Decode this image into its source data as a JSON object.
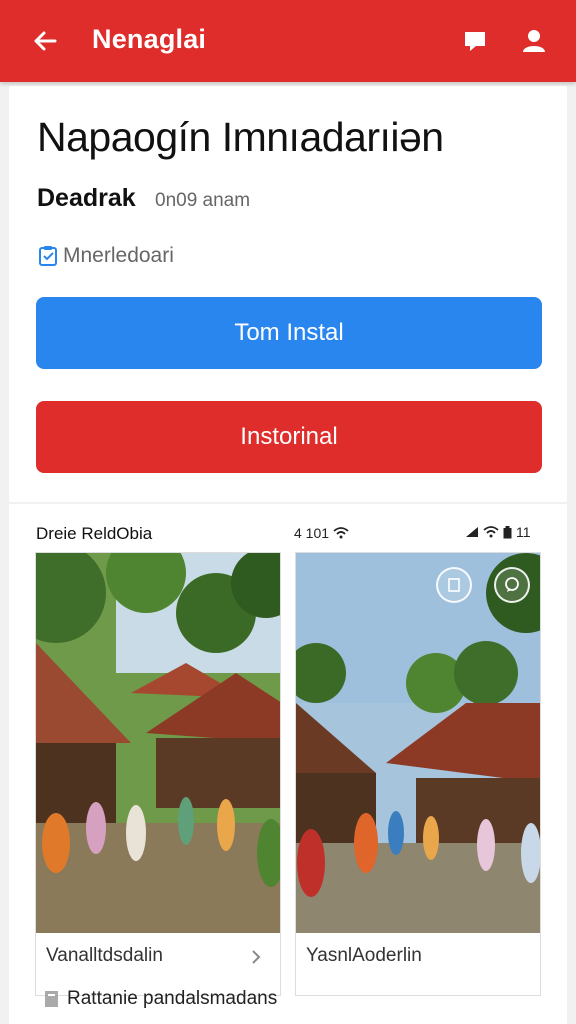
{
  "header": {
    "title": "Nenaglai",
    "back_icon": "arrow-left-icon",
    "chat_icon": "chat-bubble-icon",
    "user_icon": "user-icon",
    "color": "#de2d2a"
  },
  "app": {
    "name": "Napaogín Imnıadarıiən",
    "developer": "Deadrak",
    "meta": "0n09 anam",
    "category": "Mnerledoari"
  },
  "buttons": {
    "primary_label": "Tom Instal",
    "primary_color": "#2a86ef",
    "secondary_label": "Instorinal",
    "secondary_color": "#de2d2a"
  },
  "screenshots": {
    "heading": "Dreie ReldObia",
    "status_mid": "4 101",
    "status_right": "11",
    "items": [
      {
        "caption": "Vanalltdsdalin"
      },
      {
        "caption": "YasnlAoderlin"
      }
    ],
    "footer_label": "Rattanie pandalsmadans"
  }
}
